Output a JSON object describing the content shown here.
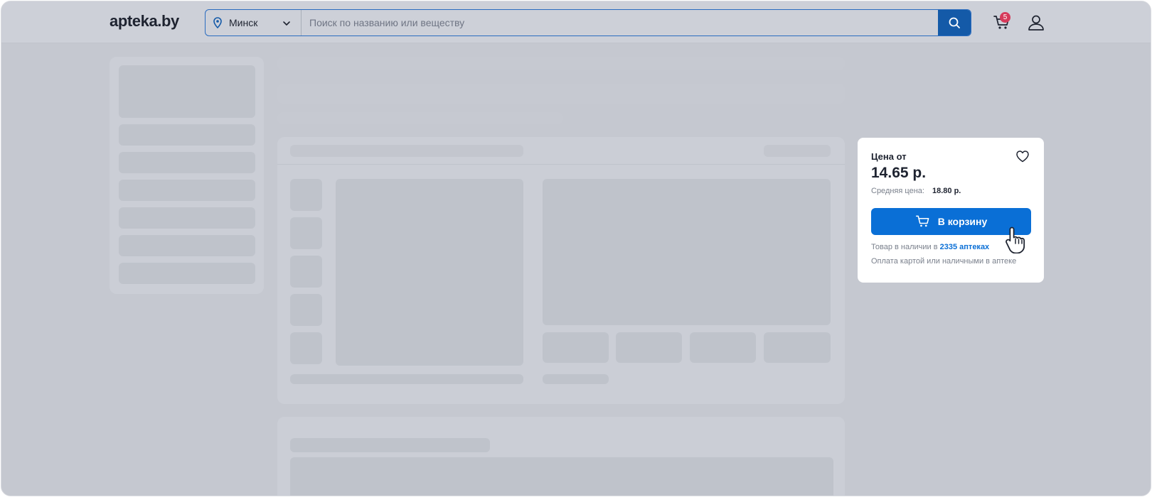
{
  "header": {
    "logo": "apteka.by",
    "city": "Минск",
    "search_placeholder": "Поиск по названию или веществу",
    "cart_count": "5"
  },
  "product_card": {
    "price_label": "Цена от",
    "price": "14.65 р.",
    "avg_price_label": "Средняя цена:",
    "avg_price": "18.80 р.",
    "add_to_cart": "В корзину",
    "availability_prefix": "Товар в наличии в",
    "availability_link": "2335 аптеках",
    "payment_note": "Оплата картой или наличными в аптеке"
  },
  "colors": {
    "accent": "#0a6fd6",
    "badge": "#d63a5a",
    "overlay": "#c5c8d0"
  }
}
